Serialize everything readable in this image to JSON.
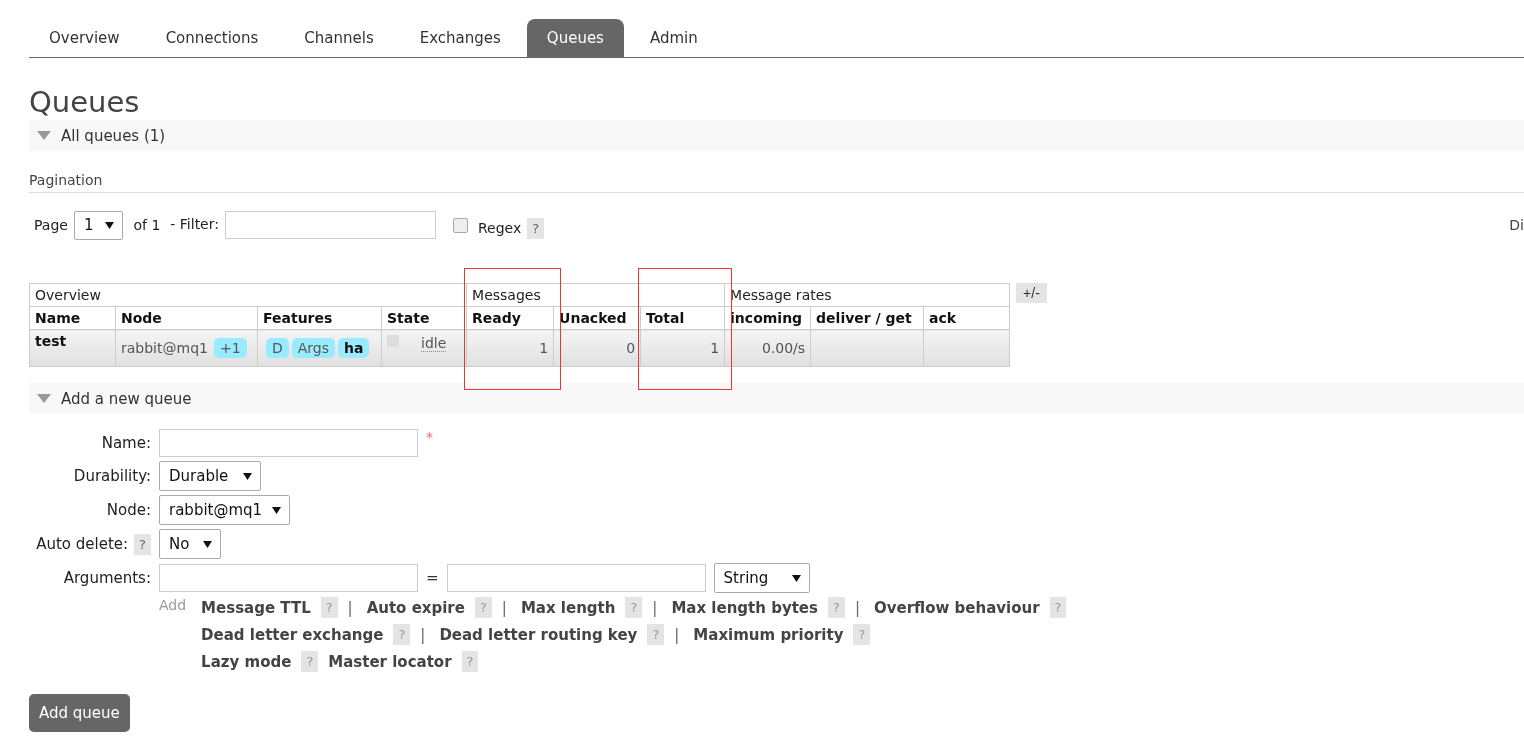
{
  "tabs": [
    {
      "label": "Overview",
      "selected": false
    },
    {
      "label": "Connections",
      "selected": false
    },
    {
      "label": "Channels",
      "selected": false
    },
    {
      "label": "Exchanges",
      "selected": false
    },
    {
      "label": "Queues",
      "selected": true
    },
    {
      "label": "Admin",
      "selected": false
    }
  ],
  "page_title": "Queues",
  "all_queues": {
    "title": "All queues (1)",
    "expanded": true
  },
  "pagination": {
    "heading": "Pagination",
    "page_label": "Page",
    "page_value": "1",
    "of_label": "of 1",
    "filter_label": "- Filter:",
    "regex_label": "Regex",
    "regex_checked": false,
    "help": "?",
    "right_text": "Di"
  },
  "table": {
    "toggle": "+/-",
    "column_groups": [
      {
        "label": "Overview",
        "columns": [
          {
            "label": "Name",
            "highlighted": false
          },
          {
            "label": "Node",
            "highlighted": false
          },
          {
            "label": "Features",
            "highlighted": false
          },
          {
            "label": "State",
            "highlighted": false
          }
        ]
      },
      {
        "label": "Messages",
        "columns": [
          {
            "label": "Ready",
            "highlighted": true
          },
          {
            "label": "Unacked",
            "highlighted": false
          },
          {
            "label": "Total",
            "highlighted": true
          }
        ]
      },
      {
        "label": "Message rates",
        "columns": [
          {
            "label": "incoming",
            "highlighted": false
          },
          {
            "label": "deliver / get",
            "highlighted": false
          },
          {
            "label": "ack",
            "highlighted": false
          }
        ]
      }
    ],
    "rows": [
      {
        "name": "test",
        "node": "rabbit@mq1",
        "node_badge": "+1",
        "features": [
          {
            "label": "D",
            "kind": "flag"
          },
          {
            "label": "Args",
            "kind": "flag"
          },
          {
            "label": "ha",
            "kind": "policy"
          }
        ],
        "state": "idle",
        "ready": "1",
        "unacked": "0",
        "total": "1",
        "incoming": "0.00/s"
      }
    ]
  },
  "add_queue": {
    "title": "Add a new queue",
    "expanded": true,
    "name": {
      "label": "Name:",
      "required_mark": "*"
    },
    "durability": {
      "label": "Durability:",
      "value": "Durable"
    },
    "node": {
      "label": "Node:",
      "value": "rabbit@mq1"
    },
    "auto_delete": {
      "label": "Auto delete:",
      "help": "?",
      "value": "No"
    },
    "arguments": {
      "label": "Arguments:",
      "equals": "=",
      "type_value": "String",
      "add_label": "Add"
    },
    "argument_lines": [
      [
        {
          "label": "Message TTL",
          "help": "?",
          "separator": "|"
        },
        {
          "label": "Auto expire",
          "help": "?",
          "separator": "|"
        },
        {
          "label": "Max length",
          "help": "?",
          "separator": "|"
        },
        {
          "label": "Max length bytes",
          "help": "?",
          "separator": "|"
        },
        {
          "label": "Overflow behaviour",
          "help": "?"
        }
      ],
      [
        {
          "label": "Dead letter exchange",
          "help": "?",
          "separator": "|"
        },
        {
          "label": "Dead letter routing key",
          "help": "?",
          "separator": "|"
        },
        {
          "label": "Maximum priority",
          "help": "?"
        }
      ],
      [
        {
          "label": "Lazy mode",
          "help": "?"
        },
        {
          "label": "Master locator",
          "help": "?"
        }
      ]
    ],
    "submit": "Add queue"
  }
}
